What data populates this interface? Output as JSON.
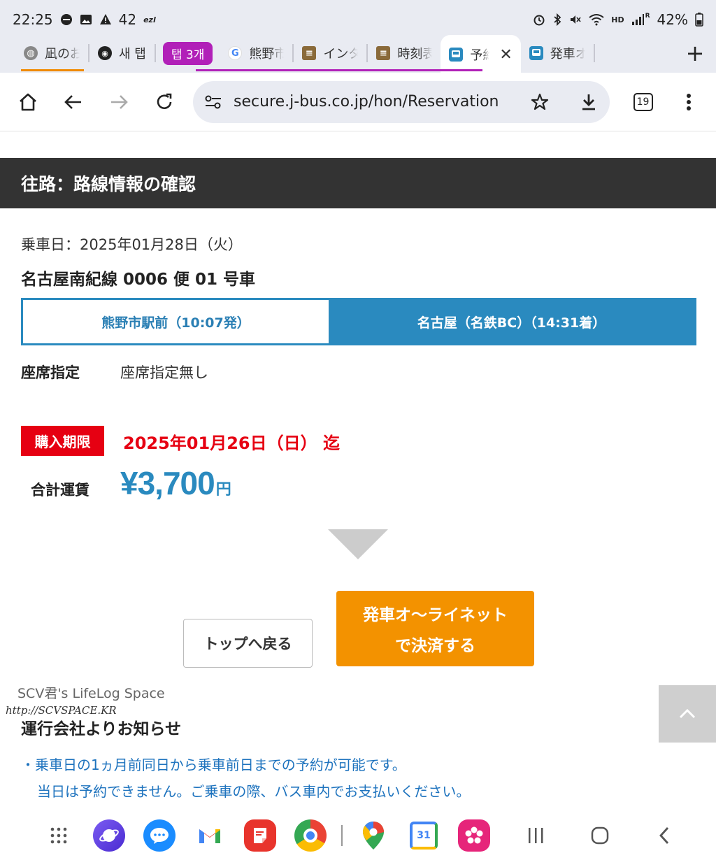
{
  "status_bar": {
    "time": "22:25",
    "notification_count": "42",
    "ezl_label": "ezl",
    "hd_label": "HD",
    "r_label": "R",
    "battery": "42%"
  },
  "tabs": {
    "items": [
      {
        "label": "凪のお",
        "favicon": "globe-icon"
      },
      {
        "label": "새 탭",
        "favicon": "chrome-icon"
      },
      {
        "label": "탭 3개",
        "group": true
      },
      {
        "label": "熊野市",
        "favicon": "google-icon"
      },
      {
        "label": "インタ",
        "favicon": "stack-icon"
      },
      {
        "label": "時刻表",
        "favicon": "stack-icon"
      },
      {
        "label": "予約",
        "favicon": "bus-icon",
        "active": true
      },
      {
        "label": "発車オ",
        "favicon": "bus-icon"
      }
    ],
    "new_tab_label": "+"
  },
  "toolbar": {
    "url": "secure.j-bus.co.jp/hon/Reservation",
    "tab_count": "19"
  },
  "page": {
    "section_title": "往路：路線情報の確認",
    "ride_date": "乗車日：2025年01月28日（火）",
    "route_title": "名古屋南紀線 0006 便 01 号車",
    "from_stop": "熊野市駅前（10:07発）",
    "to_stop": "名古屋（名鉄BC）（14:31着）",
    "seat_label": "座席指定",
    "seat_value": "座席指定無し",
    "deadline_label": "購入期限",
    "deadline_date": "2025年01月26日（日） 迄",
    "fare_label": "合計運賃",
    "fare_amount": "¥3,700",
    "fare_unit": "円",
    "back_button": "トップへ戻る",
    "pay_button_line1": "発車オ〜ライネット",
    "pay_button_line2": "で決済する",
    "notice_title": "運行会社よりお知らせ",
    "notice_line1": "・乗車日の1ヵ月前同日から乗車前日までの予約が可能です。",
    "notice_line2": "当日は予約できません。ご乗車の際、バス車内でお支払いください。"
  },
  "watermark": {
    "title": "SCV君's LifeLog Space",
    "url": "http://SCVSPACE.KR"
  },
  "dock": {
    "apps": [
      "apps-grid-icon",
      "samsung-internet-icon",
      "messages-icon",
      "gmail-icon",
      "notes-icon",
      "chrome-icon",
      "maps-icon",
      "calendar-icon",
      "gallery-icon"
    ],
    "calendar_day": "31"
  },
  "colors": {
    "accent_blue": "#2a8abf",
    "deadline_red": "#e60012",
    "pay_orange": "#f39200",
    "header_dark": "#333333",
    "tab_group_purple": "#b120b8"
  }
}
